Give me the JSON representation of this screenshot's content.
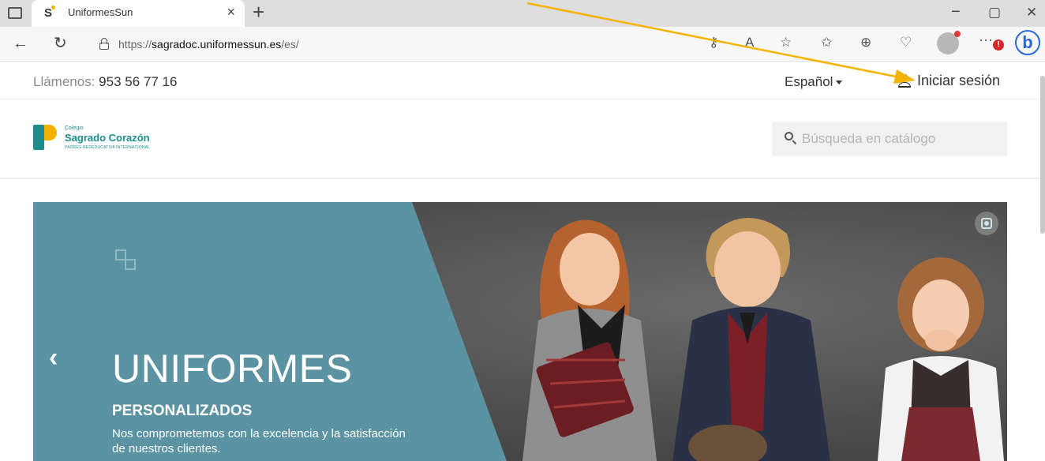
{
  "browser": {
    "tab_title": "UniformesSun",
    "tab_close": "×",
    "new_tab": "+",
    "minimize": "−",
    "restore": "▢",
    "close": "✕",
    "url_prefix": "https://",
    "url_host": "sagradoc.uniformessun.es",
    "url_path": "/es/",
    "more_label": "···",
    "error_badge": "!"
  },
  "topbar": {
    "phone_label": "Llámenos: ",
    "phone_number": "953 56 77 16",
    "language": "Español",
    "login_label": "Iniciar sesión"
  },
  "header": {
    "logo_small": "Colegio",
    "logo_name": "Sagrado Corazón",
    "logo_tag": "PADRES REDEDUCATIVA INTERNACIONAL",
    "search_placeholder": "Búsqueda en catálogo"
  },
  "hero": {
    "prev_label": "‹",
    "title": "UNIFORMES",
    "subtitle": "PERSONALIZADOS",
    "text": "Nos comprometemos con la excelencia y la satisfacción de nuestros clientes."
  },
  "colors": {
    "hero_panel": "#5b93a2",
    "brand_teal": "#1c8c8c",
    "brand_yellow": "#f0b400",
    "arrow": "#f5b301"
  }
}
